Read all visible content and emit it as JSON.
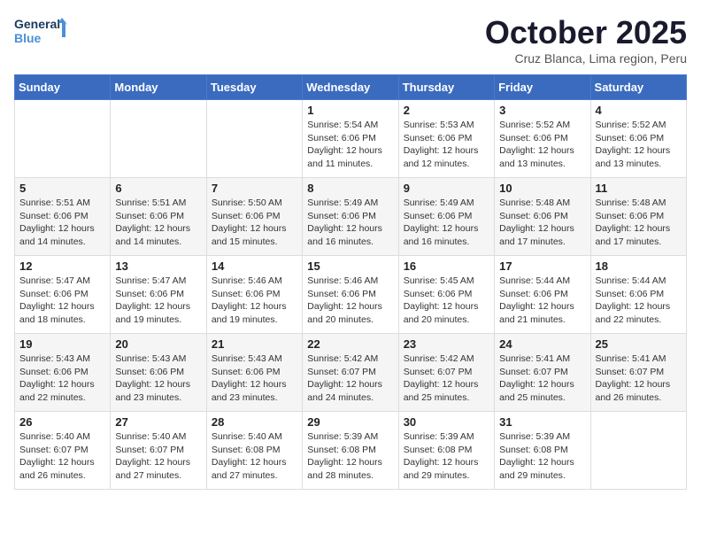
{
  "header": {
    "logo_line1": "General",
    "logo_line2": "Blue",
    "month": "October 2025",
    "location": "Cruz Blanca, Lima region, Peru"
  },
  "weekdays": [
    "Sunday",
    "Monday",
    "Tuesday",
    "Wednesday",
    "Thursday",
    "Friday",
    "Saturday"
  ],
  "weeks": [
    [
      {
        "day": "",
        "info": ""
      },
      {
        "day": "",
        "info": ""
      },
      {
        "day": "",
        "info": ""
      },
      {
        "day": "1",
        "info": "Sunrise: 5:54 AM\nSunset: 6:06 PM\nDaylight: 12 hours\nand 11 minutes."
      },
      {
        "day": "2",
        "info": "Sunrise: 5:53 AM\nSunset: 6:06 PM\nDaylight: 12 hours\nand 12 minutes."
      },
      {
        "day": "3",
        "info": "Sunrise: 5:52 AM\nSunset: 6:06 PM\nDaylight: 12 hours\nand 13 minutes."
      },
      {
        "day": "4",
        "info": "Sunrise: 5:52 AM\nSunset: 6:06 PM\nDaylight: 12 hours\nand 13 minutes."
      }
    ],
    [
      {
        "day": "5",
        "info": "Sunrise: 5:51 AM\nSunset: 6:06 PM\nDaylight: 12 hours\nand 14 minutes."
      },
      {
        "day": "6",
        "info": "Sunrise: 5:51 AM\nSunset: 6:06 PM\nDaylight: 12 hours\nand 14 minutes."
      },
      {
        "day": "7",
        "info": "Sunrise: 5:50 AM\nSunset: 6:06 PM\nDaylight: 12 hours\nand 15 minutes."
      },
      {
        "day": "8",
        "info": "Sunrise: 5:49 AM\nSunset: 6:06 PM\nDaylight: 12 hours\nand 16 minutes."
      },
      {
        "day": "9",
        "info": "Sunrise: 5:49 AM\nSunset: 6:06 PM\nDaylight: 12 hours\nand 16 minutes."
      },
      {
        "day": "10",
        "info": "Sunrise: 5:48 AM\nSunset: 6:06 PM\nDaylight: 12 hours\nand 17 minutes."
      },
      {
        "day": "11",
        "info": "Sunrise: 5:48 AM\nSunset: 6:06 PM\nDaylight: 12 hours\nand 17 minutes."
      }
    ],
    [
      {
        "day": "12",
        "info": "Sunrise: 5:47 AM\nSunset: 6:06 PM\nDaylight: 12 hours\nand 18 minutes."
      },
      {
        "day": "13",
        "info": "Sunrise: 5:47 AM\nSunset: 6:06 PM\nDaylight: 12 hours\nand 19 minutes."
      },
      {
        "day": "14",
        "info": "Sunrise: 5:46 AM\nSunset: 6:06 PM\nDaylight: 12 hours\nand 19 minutes."
      },
      {
        "day": "15",
        "info": "Sunrise: 5:46 AM\nSunset: 6:06 PM\nDaylight: 12 hours\nand 20 minutes."
      },
      {
        "day": "16",
        "info": "Sunrise: 5:45 AM\nSunset: 6:06 PM\nDaylight: 12 hours\nand 20 minutes."
      },
      {
        "day": "17",
        "info": "Sunrise: 5:44 AM\nSunset: 6:06 PM\nDaylight: 12 hours\nand 21 minutes."
      },
      {
        "day": "18",
        "info": "Sunrise: 5:44 AM\nSunset: 6:06 PM\nDaylight: 12 hours\nand 22 minutes."
      }
    ],
    [
      {
        "day": "19",
        "info": "Sunrise: 5:43 AM\nSunset: 6:06 PM\nDaylight: 12 hours\nand 22 minutes."
      },
      {
        "day": "20",
        "info": "Sunrise: 5:43 AM\nSunset: 6:06 PM\nDaylight: 12 hours\nand 23 minutes."
      },
      {
        "day": "21",
        "info": "Sunrise: 5:43 AM\nSunset: 6:06 PM\nDaylight: 12 hours\nand 23 minutes."
      },
      {
        "day": "22",
        "info": "Sunrise: 5:42 AM\nSunset: 6:07 PM\nDaylight: 12 hours\nand 24 minutes."
      },
      {
        "day": "23",
        "info": "Sunrise: 5:42 AM\nSunset: 6:07 PM\nDaylight: 12 hours\nand 25 minutes."
      },
      {
        "day": "24",
        "info": "Sunrise: 5:41 AM\nSunset: 6:07 PM\nDaylight: 12 hours\nand 25 minutes."
      },
      {
        "day": "25",
        "info": "Sunrise: 5:41 AM\nSunset: 6:07 PM\nDaylight: 12 hours\nand 26 minutes."
      }
    ],
    [
      {
        "day": "26",
        "info": "Sunrise: 5:40 AM\nSunset: 6:07 PM\nDaylight: 12 hours\nand 26 minutes."
      },
      {
        "day": "27",
        "info": "Sunrise: 5:40 AM\nSunset: 6:07 PM\nDaylight: 12 hours\nand 27 minutes."
      },
      {
        "day": "28",
        "info": "Sunrise: 5:40 AM\nSunset: 6:08 PM\nDaylight: 12 hours\nand 27 minutes."
      },
      {
        "day": "29",
        "info": "Sunrise: 5:39 AM\nSunset: 6:08 PM\nDaylight: 12 hours\nand 28 minutes."
      },
      {
        "day": "30",
        "info": "Sunrise: 5:39 AM\nSunset: 6:08 PM\nDaylight: 12 hours\nand 29 minutes."
      },
      {
        "day": "31",
        "info": "Sunrise: 5:39 AM\nSunset: 6:08 PM\nDaylight: 12 hours\nand 29 minutes."
      },
      {
        "day": "",
        "info": ""
      }
    ]
  ]
}
